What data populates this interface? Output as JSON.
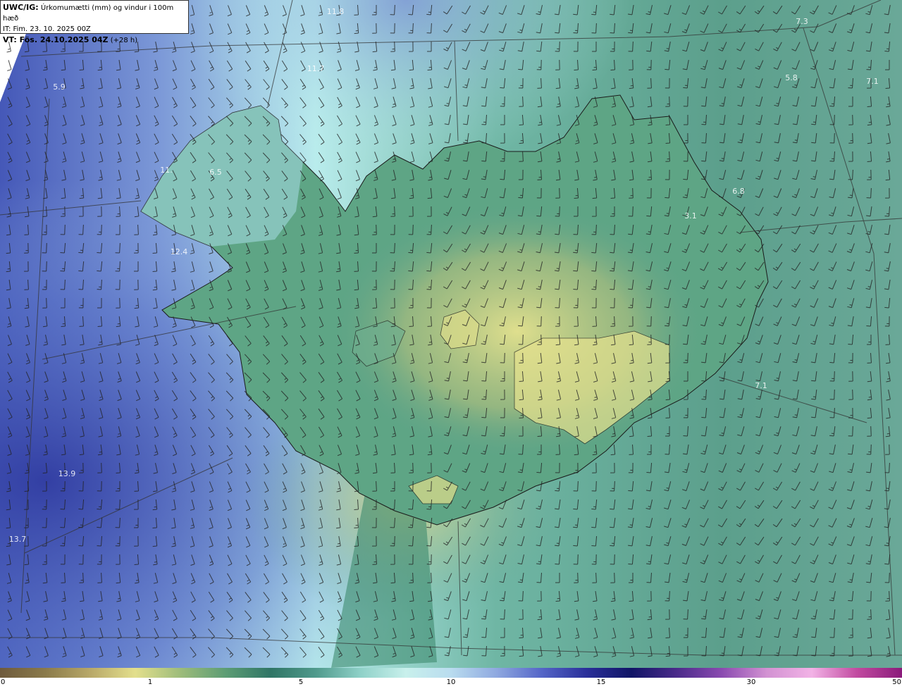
{
  "header": {
    "product": "UWC/IG:",
    "title": "Úrkomumætti (mm) og vindur i 100m hæð",
    "init_time": "IT: Fim. 23. 10. 2025 00Z",
    "valid_prefix": "VT: Fös. 24.10.2025 04Z",
    "lead_time": "(+28 h)"
  },
  "map_labels": [
    "11.8",
    "7.3",
    "5.8",
    "7.1",
    "5.9",
    "11.7",
    "11.",
    "6.5",
    "6.8",
    "3.1",
    "12.4",
    "7.1",
    "13.9",
    "13.7"
  ],
  "colorbar": {
    "ticks": [
      "0",
      "1",
      "5",
      "10",
      "15",
      "30",
      "50"
    ],
    "colors": [
      "#6e5a3c",
      "#8a7a4a",
      "#b8a868",
      "#e3df8c",
      "#9dbc7a",
      "#5c9d74",
      "#2f7565",
      "#4f9a8c",
      "#8fd1c8",
      "#c8f0ec",
      "#b9dcef",
      "#8fa9e0",
      "#5566c8",
      "#2a2f9a",
      "#101466",
      "#4a2a8a",
      "#8a4ab0",
      "#d292d2",
      "#f2b2e6",
      "#c24aa0",
      "#8a1a7a"
    ]
  }
}
